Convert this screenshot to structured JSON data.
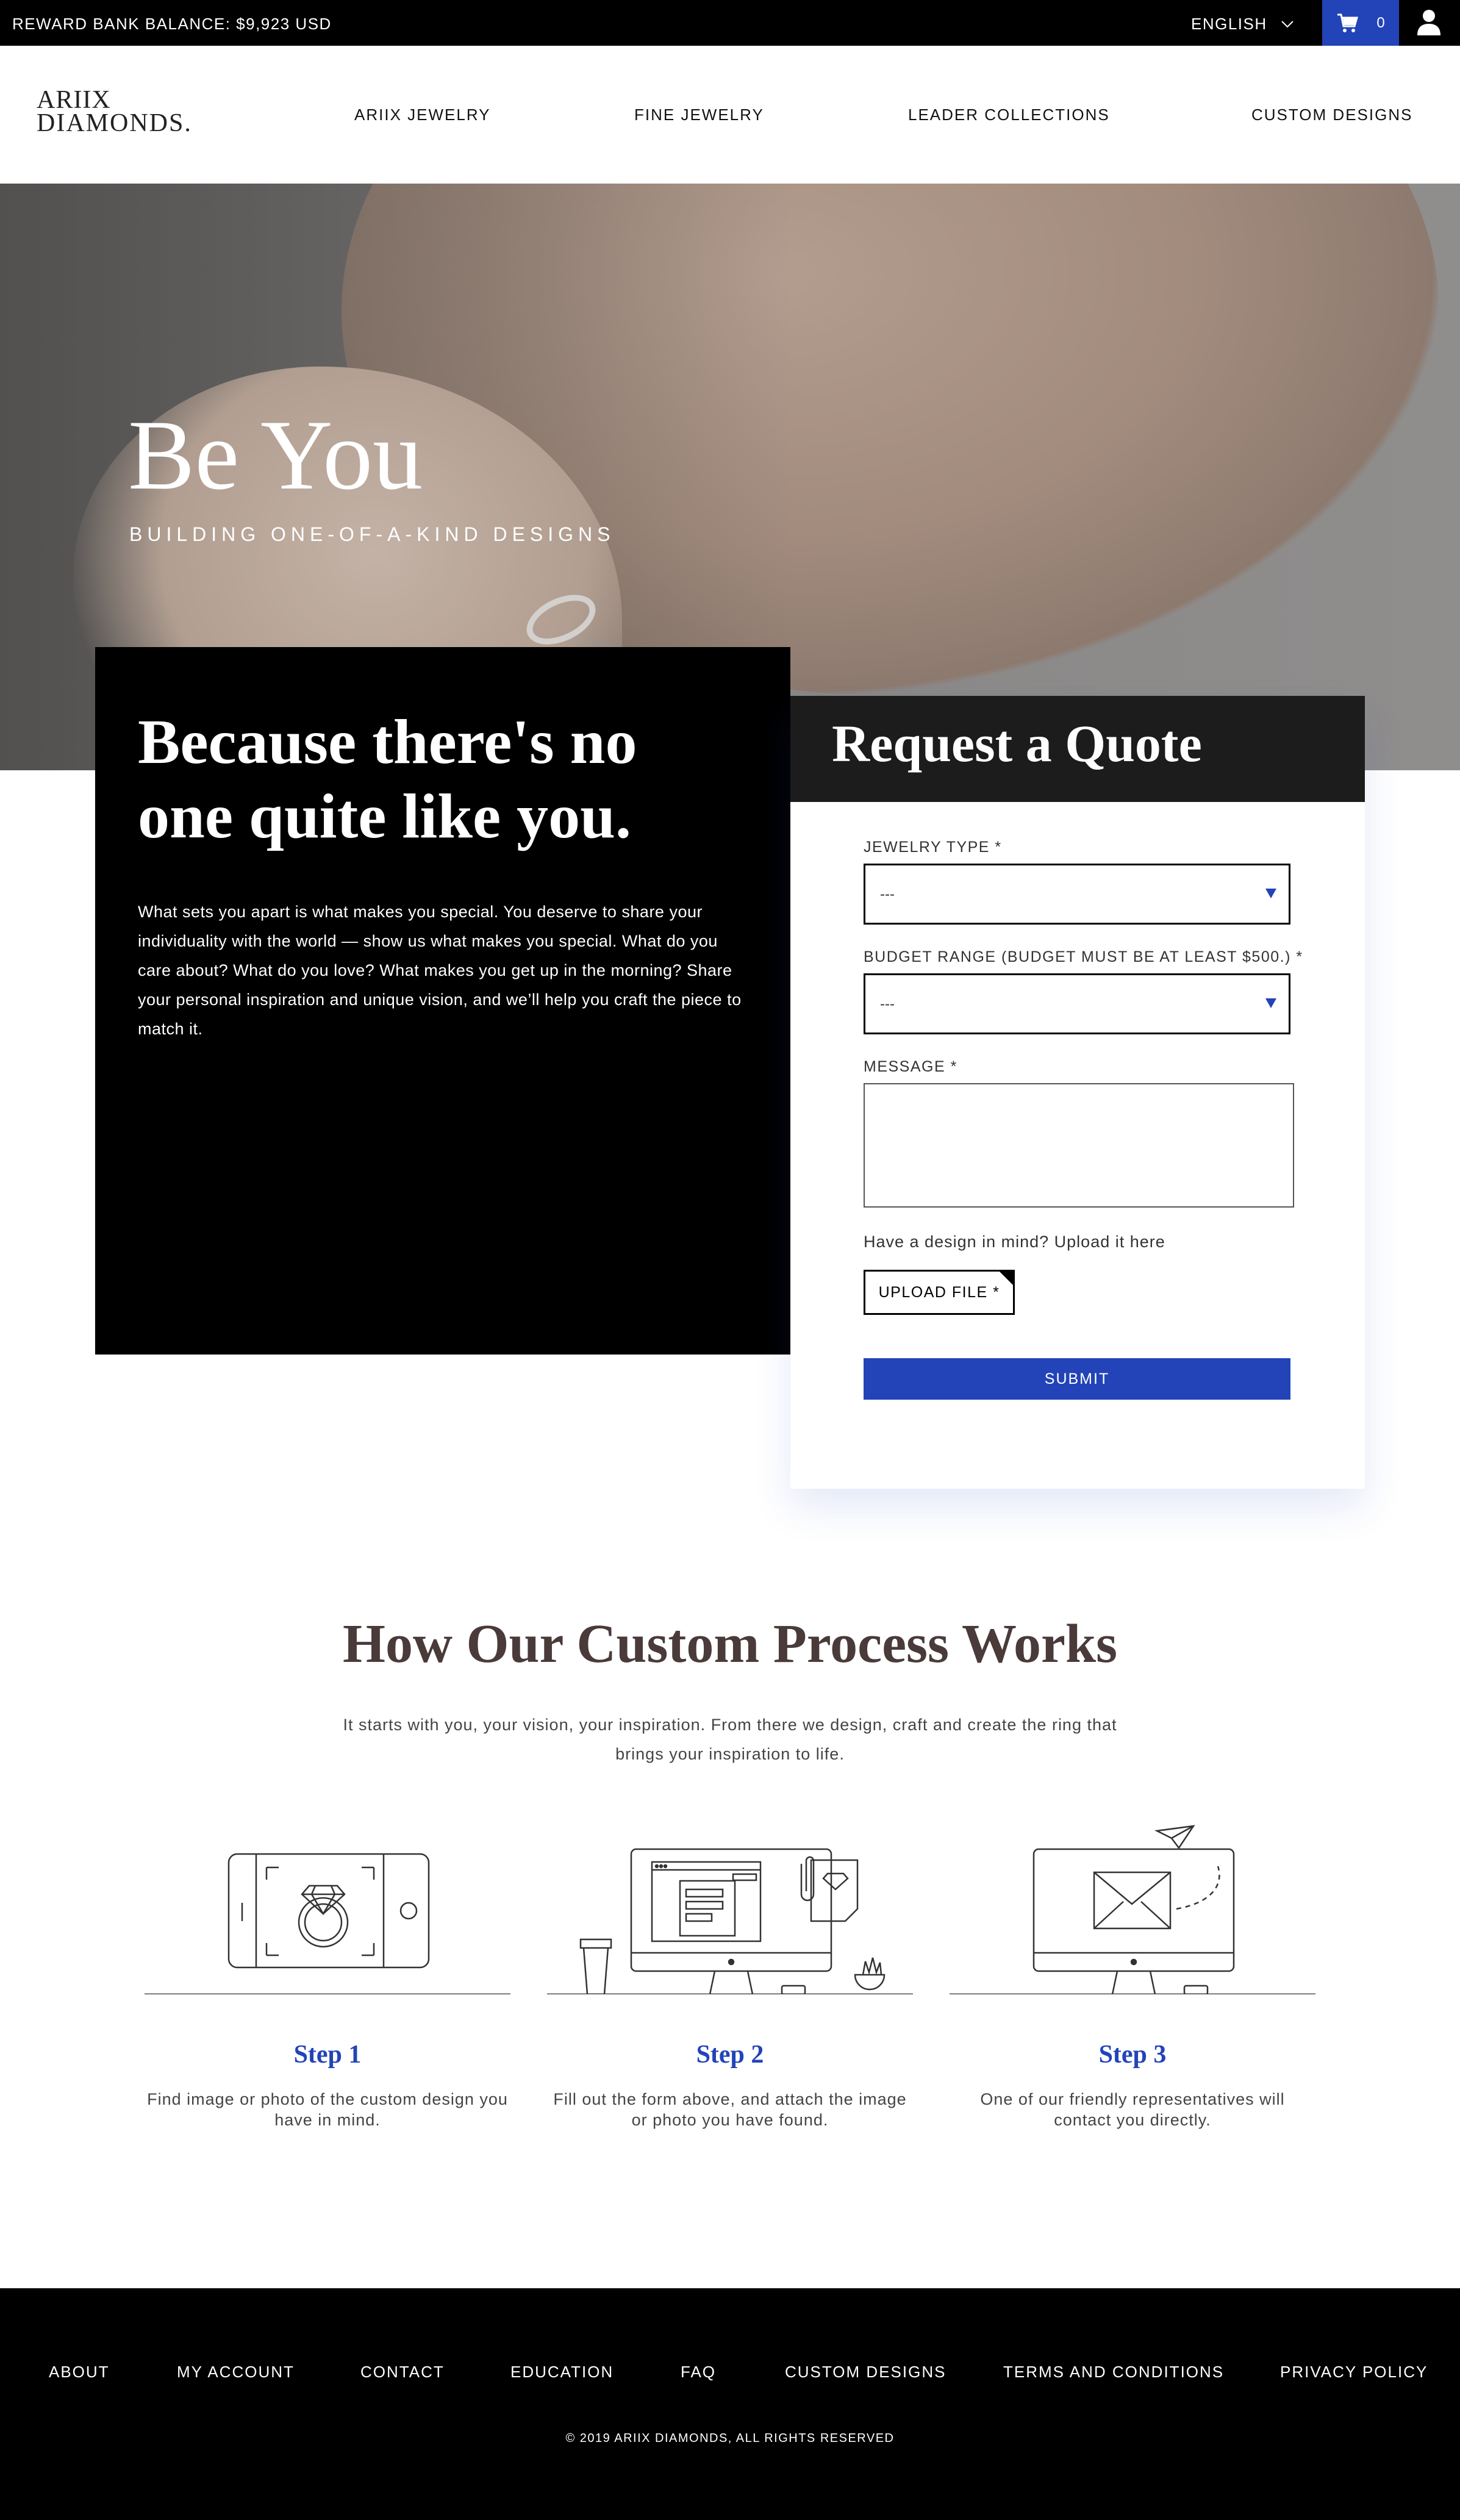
{
  "topbar": {
    "balance": "REWARD BANK BALANCE:  $9,923 USD",
    "language": "ENGLISH",
    "cart_count": "0"
  },
  "header": {
    "logo_line1": "ARIIX",
    "logo_line2": "DIAMONDS.",
    "nav": [
      "ARIIX JEWELRY",
      "FINE JEWELRY",
      "LEADER COLLECTIONS",
      "CUSTOM DESIGNS"
    ]
  },
  "hero": {
    "title": "Be You",
    "subtitle": "BUILDING ONE-OF-A-KIND DESIGNS"
  },
  "intro": {
    "heading": "Because there's no one quite like you.",
    "body": "What sets you apart is what makes you special. You deserve to share your individuality with the world — show us what makes you special. What do you care about? What do you love? What makes you get up in the morning? Share your personal inspiration and unique vision, and we’ll help you craft the piece to match it."
  },
  "quote": {
    "title": "Request a Quote",
    "jewelry_type_label": "JEWELRY TYPE *",
    "jewelry_type_value": "---",
    "budget_label": "BUDGET RANGE (BUDGET MUST BE AT LEAST $500.) *",
    "budget_value": "---",
    "message_label": "MESSAGE *",
    "upload_hint": "Have a design in mind? Upload it here",
    "upload_label": "UPLOAD FILE *",
    "submit_label": "SUBMIT"
  },
  "process": {
    "title": "How Our Custom Process Works",
    "description": "It starts with you, your vision, your inspiration. From there we design, craft and create the ring that brings your inspiration to life.",
    "steps": [
      {
        "title": "Step 1",
        "desc": "Find image or photo of the custom design you have in mind.",
        "icon": "phone-ring-icon"
      },
      {
        "title": "Step 2",
        "desc": "Fill out the form above, and attach the image or photo you have found.",
        "icon": "computer-form-icon"
      },
      {
        "title": "Step 3",
        "desc": "One of our friendly representatives will contact you directly.",
        "icon": "computer-mail-icon"
      }
    ]
  },
  "footer": {
    "links": [
      "ABOUT",
      "MY ACCOUNT",
      "CONTACT",
      "EDUCATION",
      "FAQ",
      "CUSTOM DESIGNS",
      "TERMS AND CONDITIONS",
      "PRIVACY POLICY"
    ],
    "copyright": "© 2019 ARIIX DIAMONDS,   ALL RIGHTS RESERVED"
  },
  "colors": {
    "accent_blue": "#2244b8",
    "black": "#000000",
    "heading_brown": "#4a3a3a"
  }
}
